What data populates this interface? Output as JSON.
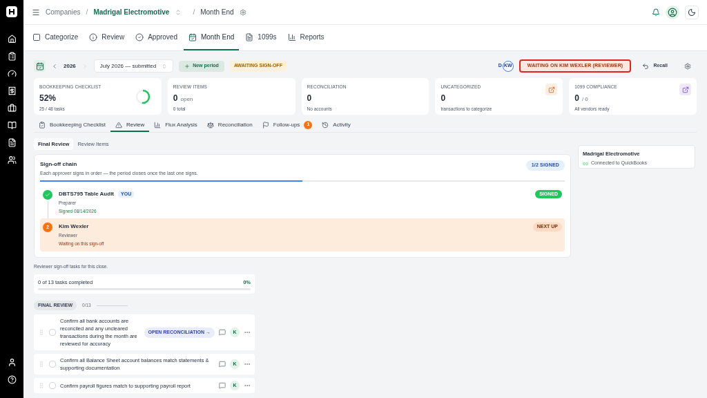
{
  "breadcrumb": {
    "root": "Companies",
    "separators": [
      "/",
      "/"
    ],
    "company": "Madrigal Electromotive",
    "page": "Month End"
  },
  "nav_tabs": [
    {
      "label": "Categorize",
      "selected": false
    },
    {
      "label": "Review",
      "selected": false
    },
    {
      "label": "Approved",
      "selected": false
    },
    {
      "label": "Month End",
      "selected": true
    },
    {
      "label": "1099s",
      "selected": false
    },
    {
      "label": "Reports",
      "selected": false
    }
  ],
  "period_bar": {
    "year": "2026",
    "period": "July 2026 — submitted",
    "new_period": "New period",
    "status": "AWAITING SIGN-OFF",
    "avatars": [
      "D",
      "KW"
    ],
    "waiting": "WAITING ON KIM WEXLER (REVIEWER)",
    "recall": "Recall"
  },
  "stat_cards": [
    {
      "kind": "ring",
      "label": "BOOKKEEPING CHECKLIST",
      "value": "52%",
      "sub": "25 / 48 tasks",
      "level": 0.52
    },
    {
      "kind": "plain",
      "label": "REVIEW ITEMS",
      "value": "0",
      "unit": "open",
      "sub": "0 total"
    },
    {
      "kind": "plain",
      "label": "RECONCILIATION",
      "value": "0",
      "sub": "No accounts"
    },
    {
      "kind": "link",
      "label": "UNCATEGORIZED",
      "value": "0",
      "sub": "transactions to categorize",
      "color": "#fdeee4"
    },
    {
      "kind": "link",
      "label": "1099 COMPLIANCE",
      "value": "0",
      "unit": "/ 0",
      "sub": "All vendors ready",
      "color": "#eee8fb"
    }
  ],
  "sub_tabs": [
    {
      "label": "Bookkeeping Checklist",
      "selected": false
    },
    {
      "label": "Review",
      "selected": true
    },
    {
      "label": "Flux Analysis",
      "selected": false
    },
    {
      "label": "Reconciliation",
      "selected": false
    },
    {
      "label": "Follow-ups",
      "selected": false,
      "badge": "1"
    },
    {
      "label": "Activity",
      "selected": false
    }
  ],
  "view_toggle": [
    {
      "label": "Final Review",
      "selected": true
    },
    {
      "label": "Review Items",
      "selected": false
    }
  ],
  "signoff": {
    "title": "Sign-off chain",
    "subtitle": "Each approver signs in order — the period closes once the last one signs.",
    "count": "1/2 SIGNED",
    "level": 0.5,
    "steps": [
      {
        "kind": "done",
        "name": "DBTS795 Table Audit",
        "you": "YOU",
        "role": "Preparer",
        "status": "Signed 08/14/2026",
        "badge": "SIGNED"
      },
      {
        "kind": "next",
        "number": "2",
        "name": "Kim Wexler",
        "role": "Reviewer",
        "status": "Waiting on this sign-off",
        "badge": "NEXT UP"
      }
    ]
  },
  "company_card": {
    "name": "Madrigal Electromotive",
    "status": "Connected to QuickBooks"
  },
  "tasks_note": "Reviewer sign-off tasks for this close.",
  "tasks_progress": {
    "label": "0 of 13 tasks completed",
    "percent": "0%",
    "level": 0
  },
  "section": {
    "label": "FINAL REVIEW",
    "count": "0/13"
  },
  "tasks": [
    {
      "text": "Confirm all bank accounts are reconciled and any uncleared transactions during the month are reviewed for accuracy",
      "checked": false,
      "action": "OPEN RECONCILIATION →",
      "assignee": "K"
    },
    {
      "text": "Confirm all Balance Sheet account balances match statements & supporting documentation",
      "checked": false,
      "assignee": "K"
    },
    {
      "text": "Confirm payroll figures match to supporting payroll report",
      "checked": false,
      "assignee": "K"
    }
  ]
}
